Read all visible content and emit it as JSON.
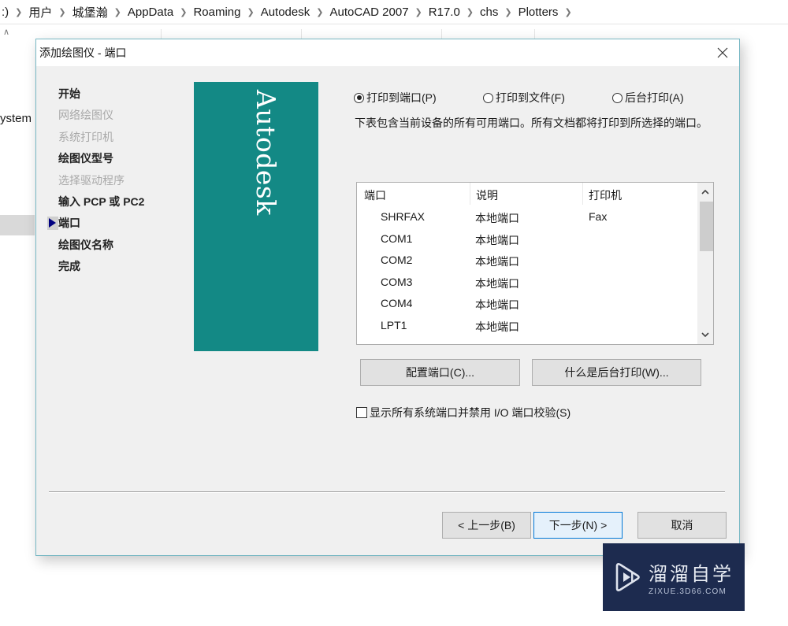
{
  "explorer": {
    "breadcrumb": [
      ":)",
      "用户",
      "城堡瀚",
      "AppData",
      "Roaming",
      "Autodesk",
      "AutoCAD 2007",
      "R17.0",
      "chs",
      "Plotters"
    ],
    "sidebar_partial_text": "ystem"
  },
  "dialog": {
    "title": "添加绘图仪 - 端口",
    "close_icon": "close-icon",
    "steps": [
      {
        "label": "开始",
        "state": "done"
      },
      {
        "label": "网络绘图仪",
        "state": "disabled"
      },
      {
        "label": "系统打印机",
        "state": "disabled"
      },
      {
        "label": "绘图仪型号",
        "state": "done"
      },
      {
        "label": "选择驱动程序",
        "state": "disabled"
      },
      {
        "label": "输入 PCP 或 PC2",
        "state": "done"
      },
      {
        "label": "端口",
        "state": "current"
      },
      {
        "label": "绘图仪名称",
        "state": "done"
      },
      {
        "label": "完成",
        "state": "done"
      }
    ],
    "brand": {
      "text": "Autodesk",
      "color": "#138985"
    },
    "radio_options": [
      {
        "label": "打印到端口(P)",
        "checked": true
      },
      {
        "label": "打印到文件(F)",
        "checked": false
      },
      {
        "label": "后台打印(A)",
        "checked": false
      }
    ],
    "description": "下表包含当前设备的所有可用端口。所有文档都将打印到所选择的端口。",
    "port_table": {
      "columns": [
        "端口",
        "说明",
        "打印机"
      ],
      "rows": [
        [
          "SHRFAX",
          "本地端口",
          "Fax"
        ],
        [
          "COM1",
          "本地端口",
          ""
        ],
        [
          "COM2",
          "本地端口",
          ""
        ],
        [
          "COM3",
          "本地端口",
          ""
        ],
        [
          "COM4",
          "本地端口",
          ""
        ],
        [
          "LPT1",
          "本地端口",
          ""
        ]
      ]
    },
    "buttons": {
      "configure_port": "配置端口(C)...",
      "what_is_spooling": "什么是后台打印(W)...",
      "back": "< 上一步(B)",
      "next": "下一步(N) >",
      "cancel": "取消"
    },
    "checkbox": {
      "label": "显示所有系统端口并禁用 I/O 端口校验(S)",
      "checked": false
    }
  },
  "watermark": {
    "name": "溜溜自学",
    "url": "ZIXUE.3D66.COM",
    "bg_color": "#1d2b4f"
  }
}
